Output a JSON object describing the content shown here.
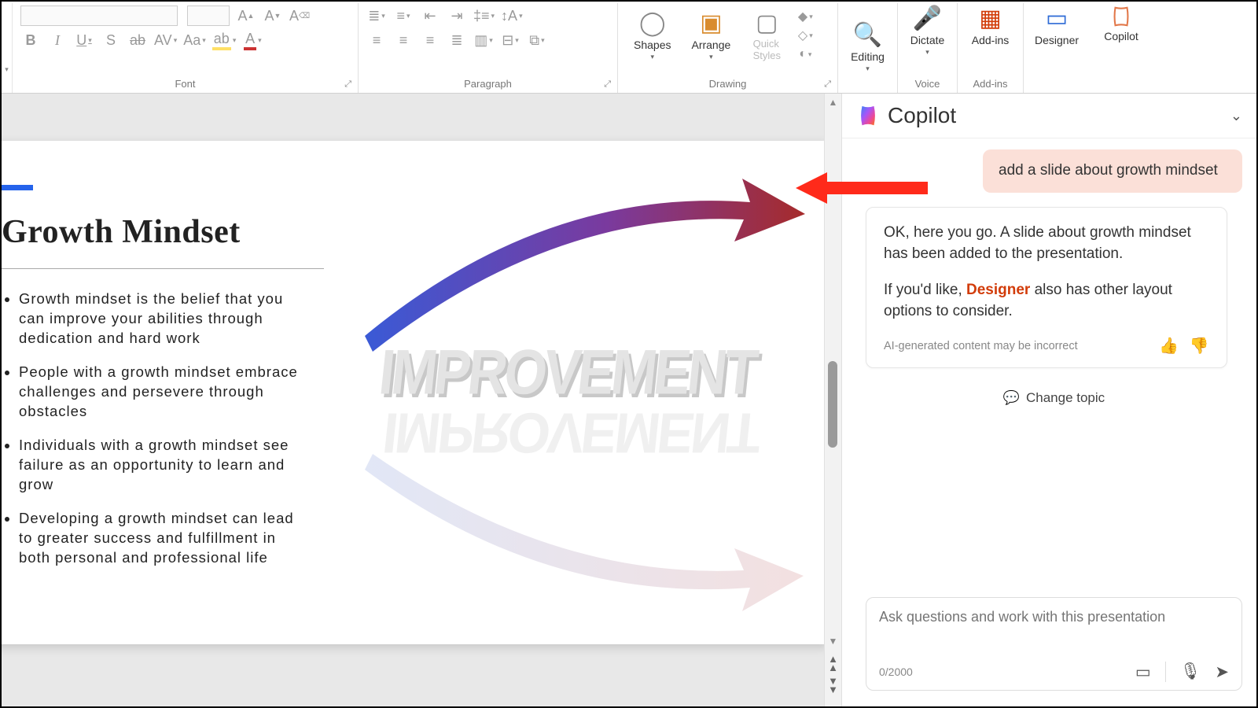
{
  "ribbon": {
    "groups": {
      "font": "Font",
      "paragraph": "Paragraph",
      "drawing": "Drawing",
      "voice": "Voice",
      "addins_group": "Add-ins"
    },
    "shapes": "Shapes",
    "arrange": "Arrange",
    "quick_styles": "Quick\nStyles",
    "editing": "Editing",
    "dictate": "Dictate",
    "addins": "Add-ins",
    "designer": "Designer",
    "copilot": "Copilot"
  },
  "slide": {
    "title": "Growth Mindset",
    "bullets": [
      "Growth mindset is the belief that you can improve your abilities through dedication and hard work",
      "People with a growth mindset embrace challenges and persevere through obstacles",
      "Individuals with a growth mindset see failure as an opportunity to learn and grow",
      "Developing a growth mindset can lead to greater success and fulfillment in both personal and professional life"
    ],
    "image_word": "IMPROVEMENT"
  },
  "copilot_panel": {
    "title": "Copilot",
    "user_msg": "add a slide about growth mindset",
    "ai_msg_1": "OK, here you go. A slide about growth mindset has been added to the presentation.",
    "ai_msg_2a": "If you'd like, ",
    "ai_msg_2b": "Designer",
    "ai_msg_2c": " also has other layout options to consider.",
    "disclaimer": "AI-generated content may be incorrect",
    "change_topic": "Change topic",
    "input_placeholder": "Ask questions and work with this presentation",
    "counter": "0/2000"
  }
}
